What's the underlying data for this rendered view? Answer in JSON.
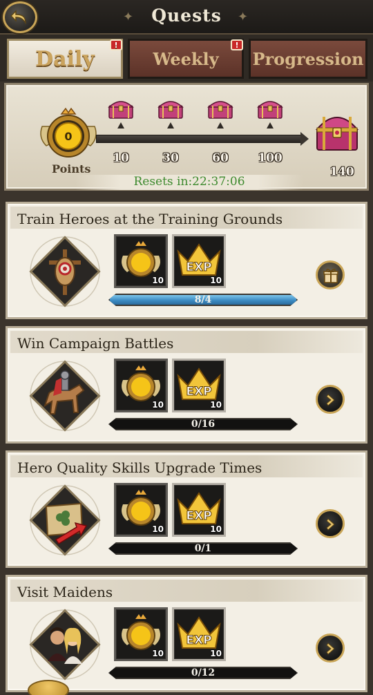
{
  "header": {
    "title": "Quests"
  },
  "tabs": [
    {
      "label": "Daily",
      "active": true,
      "badge": "!"
    },
    {
      "label": "Weekly",
      "active": false,
      "badge": "!"
    },
    {
      "label": "Progression",
      "active": false,
      "badge": ""
    }
  ],
  "points": {
    "current": "0",
    "label": "Points",
    "milestones": [
      "10",
      "30",
      "60",
      "100"
    ],
    "final": "140",
    "resets_text": "Resets in:22:37:06"
  },
  "quests": [
    {
      "title": "Train Heroes at the Training Grounds",
      "icon": "training-dummy-icon",
      "rewards": [
        {
          "icon": "points-medal-icon",
          "count": "10"
        },
        {
          "icon": "exp-crown-icon",
          "count": "10"
        }
      ],
      "progress_text": "8/4",
      "progress_fraction": 1.0,
      "action": "claim-gift"
    },
    {
      "title": "Win Campaign Battles",
      "icon": "knight-on-horse-icon",
      "rewards": [
        {
          "icon": "points-medal-icon",
          "count": "10"
        },
        {
          "icon": "exp-crown-icon",
          "count": "10"
        }
      ],
      "progress_text": "0/16",
      "progress_fraction": 0,
      "action": "go"
    },
    {
      "title": "Hero Quality Skills Upgrade Times",
      "icon": "skill-scroll-upgrade-icon",
      "rewards": [
        {
          "icon": "points-medal-icon",
          "count": "10"
        },
        {
          "icon": "exp-crown-icon",
          "count": "10"
        }
      ],
      "progress_text": "0/1",
      "progress_fraction": 0,
      "action": "go"
    },
    {
      "title": "Visit Maidens",
      "icon": "maidens-portrait-icon",
      "rewards": [
        {
          "icon": "points-medal-icon",
          "count": "10"
        },
        {
          "icon": "exp-crown-icon",
          "count": "10"
        }
      ],
      "progress_text": "0/12",
      "progress_fraction": 0,
      "action": "go"
    }
  ],
  "labels": {
    "exp": "EXP"
  },
  "colors": {
    "progress_fill": "#3d8cc4",
    "resets_text": "#3d8a2e",
    "gold_accent": "#c9a557",
    "chest_pink": "#c2417a"
  }
}
